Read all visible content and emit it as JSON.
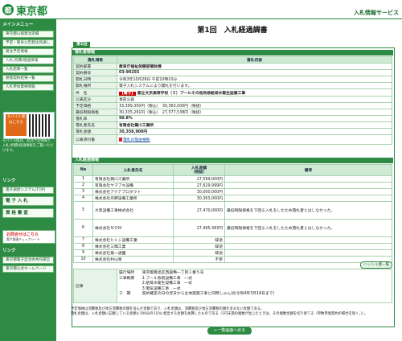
{
  "header": {
    "logo_mark": "都",
    "logo_text": "東京都",
    "service": "入札情報サービス"
  },
  "sidebar": {
    "menu_title": "メインメニュー",
    "items": [
      {
        "label": "東京都公報発注実績"
      },
      {
        "label": "予定・競争公告発注見通し"
      },
      {
        "label": "発注予定情報"
      },
      {
        "label": "入札(見積)経過情報"
      },
      {
        "label": "入札結果一覧"
      },
      {
        "label": "随意契約結果一覧"
      },
      {
        "label": "入札参加資格情報"
      }
    ],
    "mobile_label": "モバイル版はこちら",
    "mobile_note": "モバイル版は、発注予定情報と入札(見積)経過情報をご覧いただけます。",
    "links_title": "リンク",
    "ebid": "電子調達システム(TOP)",
    "big1": "電 子 入 札",
    "big2": "資 格 審 査",
    "check_t1": "お問合せはこちら",
    "check_t2": "電子調達チェックシート",
    "link_bottom_title": "リンク",
    "link1": "東京都電子自治体共同運営",
    "link2": "東京都公式ホームページ"
  },
  "page": {
    "title": "第1回　入札経過調書",
    "tab": "第1回"
  },
  "bid_info": {
    "section": "落札者情報",
    "col_item": "落札項目",
    "col_content": "落札内容",
    "rows": [
      {
        "label": "契約部署",
        "value": "教育庁福祉保健部管財課"
      },
      {
        "label": "契約番号",
        "value": "03-90255"
      },
      {
        "label": "開札日時",
        "value": "令和3年10月28日 午前10時10分"
      },
      {
        "label": "開札場所",
        "value": "電子入札システムにより開札を行います。"
      },
      {
        "label": "件　名",
        "badge": "【電子】",
        "value": "都立文京高等学校（３）プールその他改修給排水衛生設備工事"
      },
      {
        "label": "公表区分",
        "value": "事前公表"
      },
      {
        "label": "予定価格",
        "value": "33,399,300円（税込）　30,363,000円（税抜）"
      },
      {
        "label": "最低制限価格",
        "value": "30,335,291円（税込）　27,577,538円（税抜）"
      },
      {
        "label": "落札率",
        "value": "90.8%"
      },
      {
        "label": "落札者氏名",
        "value": "有限会社鵜川工業所"
      },
      {
        "label": "落札金額",
        "value": "30,358,900円"
      },
      {
        "label": "公表添付書",
        "value": "落札の理由根拠"
      }
    ]
  },
  "bid_progress": {
    "section": "入札経過情報",
    "col_no": "No",
    "col_name": "入札者氏名",
    "col_amount": "入札金額\n（税抜）",
    "col_note": "備考",
    "rows": [
      {
        "no": "1",
        "name": "有限会社鵜川工業所",
        "amount": "27,599,000円",
        "note": ""
      },
      {
        "no": "2",
        "name": "有限会社ヤマブキ設備",
        "amount": "27,629,999円",
        "note": ""
      },
      {
        "no": "3",
        "name": "株式会社アクアプロダクト",
        "amount": "30,000,000円",
        "note": ""
      },
      {
        "no": "4",
        "name": "株式会社丹野設備工業所",
        "amount": "30,363,000円",
        "note": ""
      },
      {
        "no": "5",
        "name": "大高設備工事株式会社",
        "amount": "27,470,000円",
        "note": "最低制限価格を下回る入札をしたため落札者とはしなかった。"
      },
      {
        "no": "6",
        "name": "株式会社ＮＯＭ",
        "amount": "27,495,383円",
        "note": "最低制限価格を下回る入札をしたため落札者とはしなかった。"
      },
      {
        "no": "7",
        "name": "株式会社ヒトシ設備工業",
        "amount": "辞退",
        "note": ""
      },
      {
        "no": "8",
        "name": "株式会社三輝工業",
        "amount": "辞退",
        "note": ""
      },
      {
        "no": "9",
        "name": "株式会社第一通園",
        "amount": "辞退",
        "note": ""
      },
      {
        "no": "10",
        "name": "株式会社村山幸",
        "amount": "不参",
        "note": ""
      }
    ],
    "history_btn": "ハッシュ値一覧",
    "remarks_label": "記事",
    "remarks": [
      "履行場所　　東京都豊島区西巣鴨一丁目１番５号",
      "工事概要　　1.プール系統設備工事　一式",
      "　　　　　　2.給排水衛生設備工事　一式",
      "　　　　　　3.電気設備工事　一式",
      "工　期　　　契約確定の日の翌日から主体建築工事と同時しゅん功(令和4年3月18日まで)"
    ]
  },
  "footer": {
    "note1": "予定価格は消費税及び地方消費税の額を含んだ金額であり、入札金額は、消費税及び地方消費税の額を含まない金額である。",
    "note2": "落札金額は、入札金額に記載している金額に100分の110に相当する金額を加算したものである（1円未満の端数が生じたときは、その端数金額を切り捨てる（単数単価契約の場合を除く。））。",
    "back_btn": "←一覧画面へ戻る"
  },
  "colors": {
    "accent": "#2e8b43",
    "header_bg": "#cfe9d4",
    "label_bg": "#e6f4e8"
  }
}
